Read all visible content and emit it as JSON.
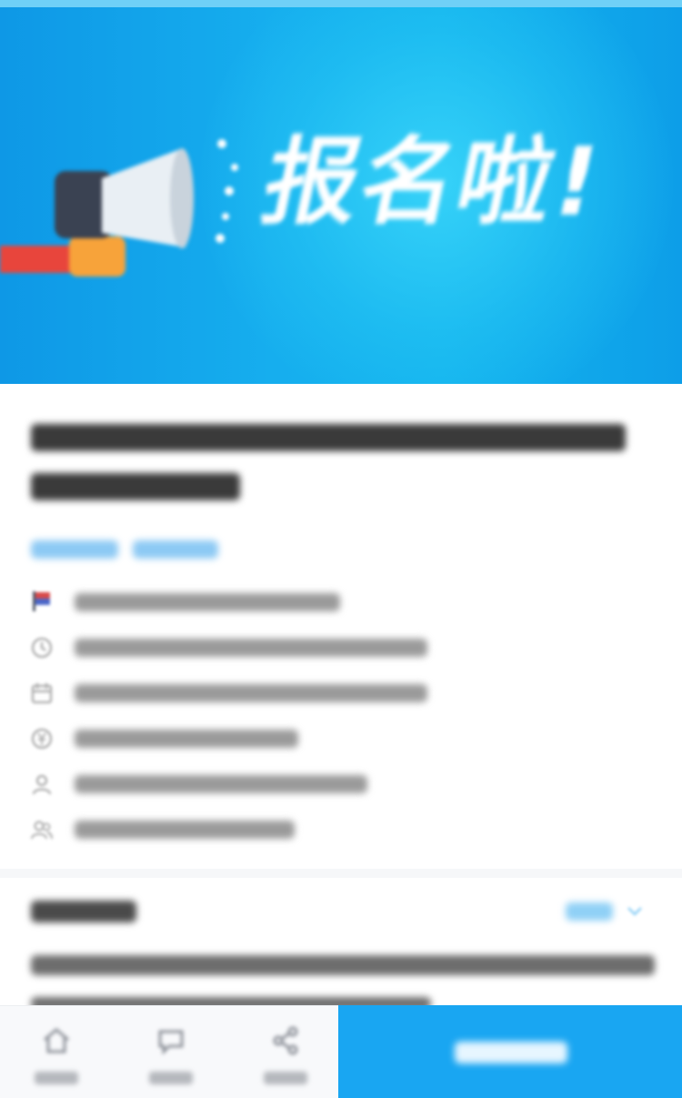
{
  "banner": {
    "headline": "报名啦!",
    "background_color": "#16aeee",
    "glow_color": "#3cd7fa"
  },
  "colors": {
    "primary": "#19a6f2",
    "title_text": "#333333",
    "meta_text": "#888888",
    "tag_text": "#8cc9f4",
    "megaphone_handle": "#e8453c",
    "megaphone_grip": "#f7a33a"
  },
  "info_rows": [
    {
      "icon": "flag-icon"
    },
    {
      "icon": "clock-icon"
    },
    {
      "icon": "calendar-icon"
    },
    {
      "icon": "yen-icon"
    },
    {
      "icon": "user-icon"
    },
    {
      "icon": "group-icon"
    }
  ],
  "details": {
    "expand_icon": "chevron-down-icon"
  },
  "bottom_bar": {
    "actions": [
      {
        "icon": "home-icon"
      },
      {
        "icon": "comment-icon"
      },
      {
        "icon": "share-icon"
      }
    ]
  }
}
